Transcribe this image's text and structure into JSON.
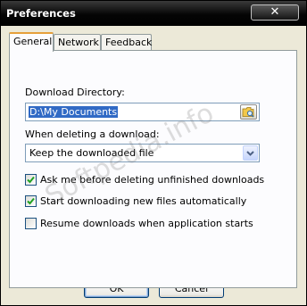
{
  "window": {
    "title": "Preferences",
    "close_glyph": "✕"
  },
  "tabs": [
    {
      "label": "General",
      "active": true
    },
    {
      "label": "Network",
      "active": false
    },
    {
      "label": "Feedback",
      "active": false
    }
  ],
  "general": {
    "download_directory_label": "Download Directory:",
    "download_directory_value": "D:\\My Documents",
    "browse_icon": "folder-browse-icon",
    "delete_label": "When deleting a download:",
    "delete_selected": "Keep the downloaded file",
    "checkboxes": [
      {
        "label": "Ask me before deleting unfinished downloads",
        "checked": true
      },
      {
        "label": "Start downloading new files automatically",
        "checked": true
      },
      {
        "label": "Resume downloads when application starts",
        "checked": false
      }
    ]
  },
  "buttons": {
    "ok": "OK",
    "cancel": "Cancel"
  },
  "watermark": "Softpedia.info"
}
